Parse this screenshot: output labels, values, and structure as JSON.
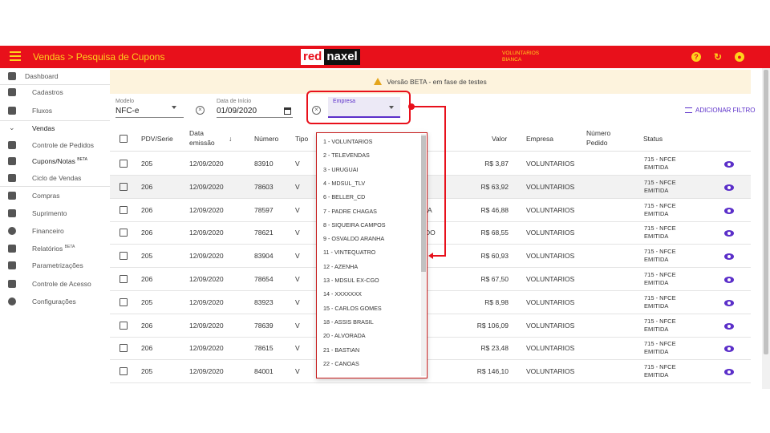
{
  "header": {
    "title": "Vendas > Pesquisa de Cupons",
    "logo_red": "red",
    "logo_black": "naxel",
    "user_line1": "VOLUNTARIOS",
    "user_line2": "BIANCA",
    "icons": [
      "help-icon",
      "refresh-icon",
      "account-icon"
    ]
  },
  "sidebar": {
    "items": [
      {
        "label": "Dashboard",
        "icon": "dashboard-icon"
      },
      {
        "label": "Cadastros",
        "icon": "folder-icon"
      },
      {
        "label": "Fluxos",
        "icon": "columns-icon"
      },
      {
        "label": "Vendas",
        "icon": "chevron-down-icon"
      },
      {
        "label": "Controle de Pedidos",
        "icon": "list-icon"
      },
      {
        "label": "Cupons/Notas",
        "badge": "BETA",
        "icon": "receipt-search-icon"
      },
      {
        "label": "Ciclo de Vendas",
        "icon": "infinity-icon"
      },
      {
        "label": "Compras",
        "icon": "building-icon"
      },
      {
        "label": "Suprimento",
        "icon": "crop-icon"
      },
      {
        "label": "Financeiro",
        "icon": "dollar-icon"
      },
      {
        "label": "Relatórios",
        "badge": "BETA",
        "icon": "print-icon"
      },
      {
        "label": "Parametrizações",
        "icon": "sliders-icon"
      },
      {
        "label": "Controle de Acesso",
        "icon": "shield-icon"
      },
      {
        "label": "Configurações",
        "icon": "gear-icon"
      }
    ]
  },
  "banner": {
    "text": "Versão BETA - em fase de testes"
  },
  "filters": {
    "modelo": {
      "label": "Modelo",
      "value": "NFC-e"
    },
    "data_inicio": {
      "label": "Data de Início",
      "value": "01/09/2020"
    },
    "empresa": {
      "label": "Empresa",
      "value": ""
    },
    "add_filter": "ADICIONAR FILTRO"
  },
  "table": {
    "headers": {
      "pdv": "PDV/Serie",
      "data1": "Data",
      "data2": "emissão",
      "numero": "Número",
      "tipo": "Tipo",
      "valor": "Valor",
      "empresa": "Empresa",
      "pedido1": "Número",
      "pedido2": "Pedido",
      "status": "Status"
    },
    "rows": [
      {
        "pdv": "205",
        "data": "12/09/2020",
        "numero": "83910",
        "tipo": "V",
        "valor": "R$ 3,87",
        "empresa": "VOLUNTARIOS",
        "status1": "715 - NFCE",
        "status2": "EMITIDA"
      },
      {
        "pdv": "206",
        "data": "12/09/2020",
        "numero": "78603",
        "tipo": "V",
        "valor": "R$ 63,92",
        "empresa": "VOLUNTARIOS",
        "status1": "715 - NFCE",
        "status2": "EMITIDA"
      },
      {
        "pdv": "206",
        "data": "12/09/2020",
        "numero": "78597",
        "tipo": "V",
        "valor": "R$ 46,88",
        "empresa": "VOLUNTARIOS",
        "status1": "715 - NFCE",
        "status2": "EMITIDA"
      },
      {
        "pdv": "206",
        "data": "12/09/2020",
        "numero": "78621",
        "tipo": "V",
        "valor": "R$ 68,55",
        "empresa": "VOLUNTARIOS",
        "status1": "715 - NFCE",
        "status2": "EMITIDA"
      },
      {
        "pdv": "205",
        "data": "12/09/2020",
        "numero": "83904",
        "tipo": "V",
        "valor": "R$ 60,93",
        "empresa": "VOLUNTARIOS",
        "status1": "715 - NFCE",
        "status2": "EMITIDA"
      },
      {
        "pdv": "206",
        "data": "12/09/2020",
        "numero": "78654",
        "tipo": "V",
        "valor": "R$ 67,50",
        "empresa": "VOLUNTARIOS",
        "status1": "715 - NFCE",
        "status2": "EMITIDA"
      },
      {
        "pdv": "205",
        "data": "12/09/2020",
        "numero": "83923",
        "tipo": "V",
        "valor": "R$ 8,98",
        "empresa": "VOLUNTARIOS",
        "status1": "715 - NFCE",
        "status2": "EMITIDA"
      },
      {
        "pdv": "206",
        "data": "12/09/2020",
        "numero": "78639",
        "tipo": "V",
        "valor": "R$ 106,09",
        "empresa": "VOLUNTARIOS",
        "status1": "715 - NFCE",
        "status2": "EMITIDA"
      },
      {
        "pdv": "206",
        "data": "12/09/2020",
        "numero": "78615",
        "tipo": "V",
        "valor": "R$ 23,48",
        "empresa": "VOLUNTARIOS",
        "status1": "715 - NFCE",
        "status2": "EMITIDA"
      },
      {
        "pdv": "205",
        "data": "12/09/2020",
        "numero": "84001",
        "tipo": "V",
        "valor": "R$ 146,10",
        "empresa": "VOLUNTARIOS",
        "status1": "715 - NFCE",
        "status2": "EMITIDA"
      }
    ],
    "partial_texts": {
      "row3": "A",
      "row4": "DO"
    }
  },
  "dropdown": {
    "options": [
      "1 - VOLUNTARIOS",
      "2 - TELEVENDAS",
      "3 - URUGUAI",
      "4 - MDSUL_TLV",
      "6 - BELLER_CD",
      "7 - PADRE CHAGAS",
      "8 - SIQUEIRA CAMPOS",
      "9 - OSVALDO ARANHA",
      "11 - VINTEQUATRO",
      "12 - AZENHA",
      "13 - MDSUL EX-CGO",
      "14 - XXXXXXX",
      "15 - CARLOS GOMES",
      "18 - ASSIS BRASIL",
      "20 - ALVORADA",
      "21 - BASTIAN",
      "22 - CANOAS"
    ]
  },
  "colors": {
    "brand_red": "#e8101b",
    "brand_yellow": "#ffd21c",
    "accent_purple": "#5b2fc9"
  }
}
